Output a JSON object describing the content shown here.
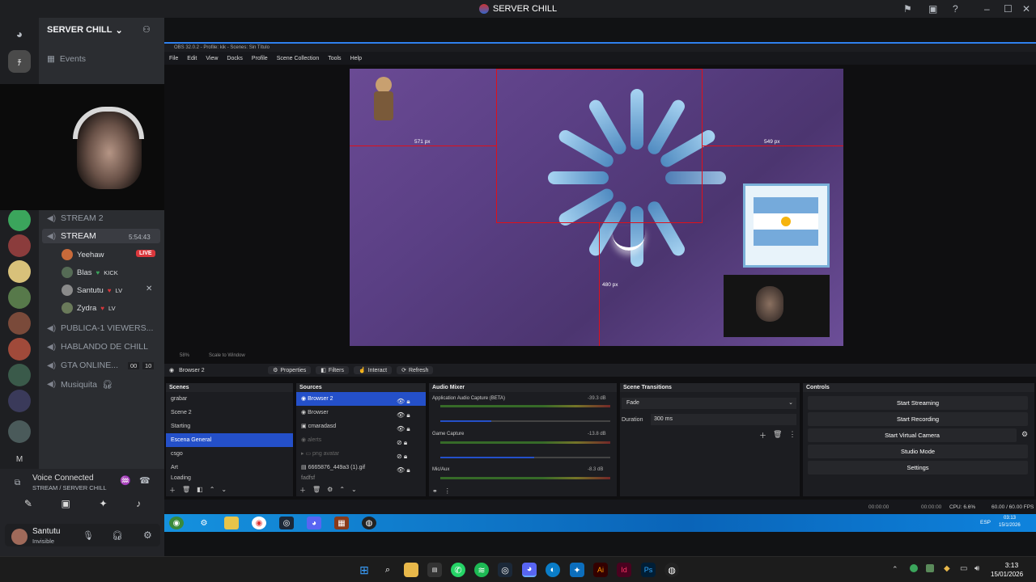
{
  "window": {
    "title": "SERVER CHILL"
  },
  "discord": {
    "server_name": "SERVER CHILL",
    "events_label": "Events",
    "channels": [
      {
        "name": "STREAM 2",
        "type": "voice"
      },
      {
        "name": "STREAM",
        "type": "voice",
        "timer": "5:54:43",
        "active": true
      },
      {
        "name": "PUBLICA-1 VIEWERS...",
        "type": "voice"
      },
      {
        "name": "HABLANDO DE CHILL",
        "type": "voice"
      },
      {
        "name": "GTA ONLINE...",
        "type": "voice",
        "count_a": "00",
        "count_b": "10"
      },
      {
        "name": "Musiquita",
        "type": "voice"
      }
    ],
    "stream_users": [
      {
        "name": "Yeehaw",
        "badge": "LIVE"
      },
      {
        "name": "Blas",
        "tag": "KICK"
      },
      {
        "name": "Santutu",
        "tag": "LV"
      },
      {
        "name": "Zydra",
        "tag": "LV"
      }
    ],
    "voice": {
      "status": "Voice Connected",
      "location": "STREAM / SERVER CHILL"
    },
    "me": {
      "name": "Santutu",
      "status": "Invisible"
    }
  },
  "obs": {
    "title": "OBS 32.0.2 - Profile: kik - Scenes: Sin Título",
    "menu": [
      "File",
      "Edit",
      "View",
      "Docks",
      "Profile",
      "Scene Collection",
      "Tools",
      "Help"
    ],
    "guide_labels": {
      "left": "571 px",
      "right": "549 px",
      "bottom": "480 px"
    },
    "zoom_labels": {
      "left": "58%",
      "scale": "Scale to Window"
    },
    "selected_source": "Browser 2",
    "source_toolbar": [
      "Properties",
      "Filters",
      "Interact",
      "Refresh"
    ],
    "scenes_title": "Scenes",
    "scenes": [
      "grabar",
      "Scene 2",
      "Starting",
      "Escena General",
      "csgo",
      "Art",
      "Loading"
    ],
    "selected_scene": "Escena General",
    "sources_title": "Sources",
    "sources": [
      "Browser 2",
      "Browser",
      "cmaradasd",
      "alerts",
      "png avatar",
      "6665876_449a3 (1).gif",
      "fadfsf"
    ],
    "mixer_title": "Audio Mixer",
    "mixer": [
      {
        "name": "Application Audio Capture (BETA)",
        "db": "-39.3 dB",
        "level": 0.3
      },
      {
        "name": "Game Capture",
        "db": "-13.8 dB",
        "level": 0.55
      },
      {
        "name": "Mic/Aux",
        "db": "-8.3 dB",
        "level": 0.65
      }
    ],
    "transitions_title": "Scene Transitions",
    "transition": "Fade",
    "duration_label": "Duration",
    "duration_value": "300 ms",
    "controls_title": "Controls",
    "controls": [
      "Start Streaming",
      "Start Recording",
      "Start Virtual Camera",
      "Studio Mode",
      "Settings"
    ],
    "status": {
      "live": "00:00:00",
      "rec": "00:00:00",
      "cpu": "CPU: 6.6%",
      "fps": "60.00 / 60.00 FPS"
    },
    "inner_clock": {
      "time": "03:13",
      "date": "15/1/2026"
    },
    "inner_lang": "ESP"
  },
  "taskbar": {
    "time": "3:13",
    "date": "15/01/2026"
  },
  "colors": {
    "obs_accent": "#2450c9",
    "discord_bg": "#2b2d31",
    "guide": "#e0101a",
    "live_badge": "#da373c"
  }
}
